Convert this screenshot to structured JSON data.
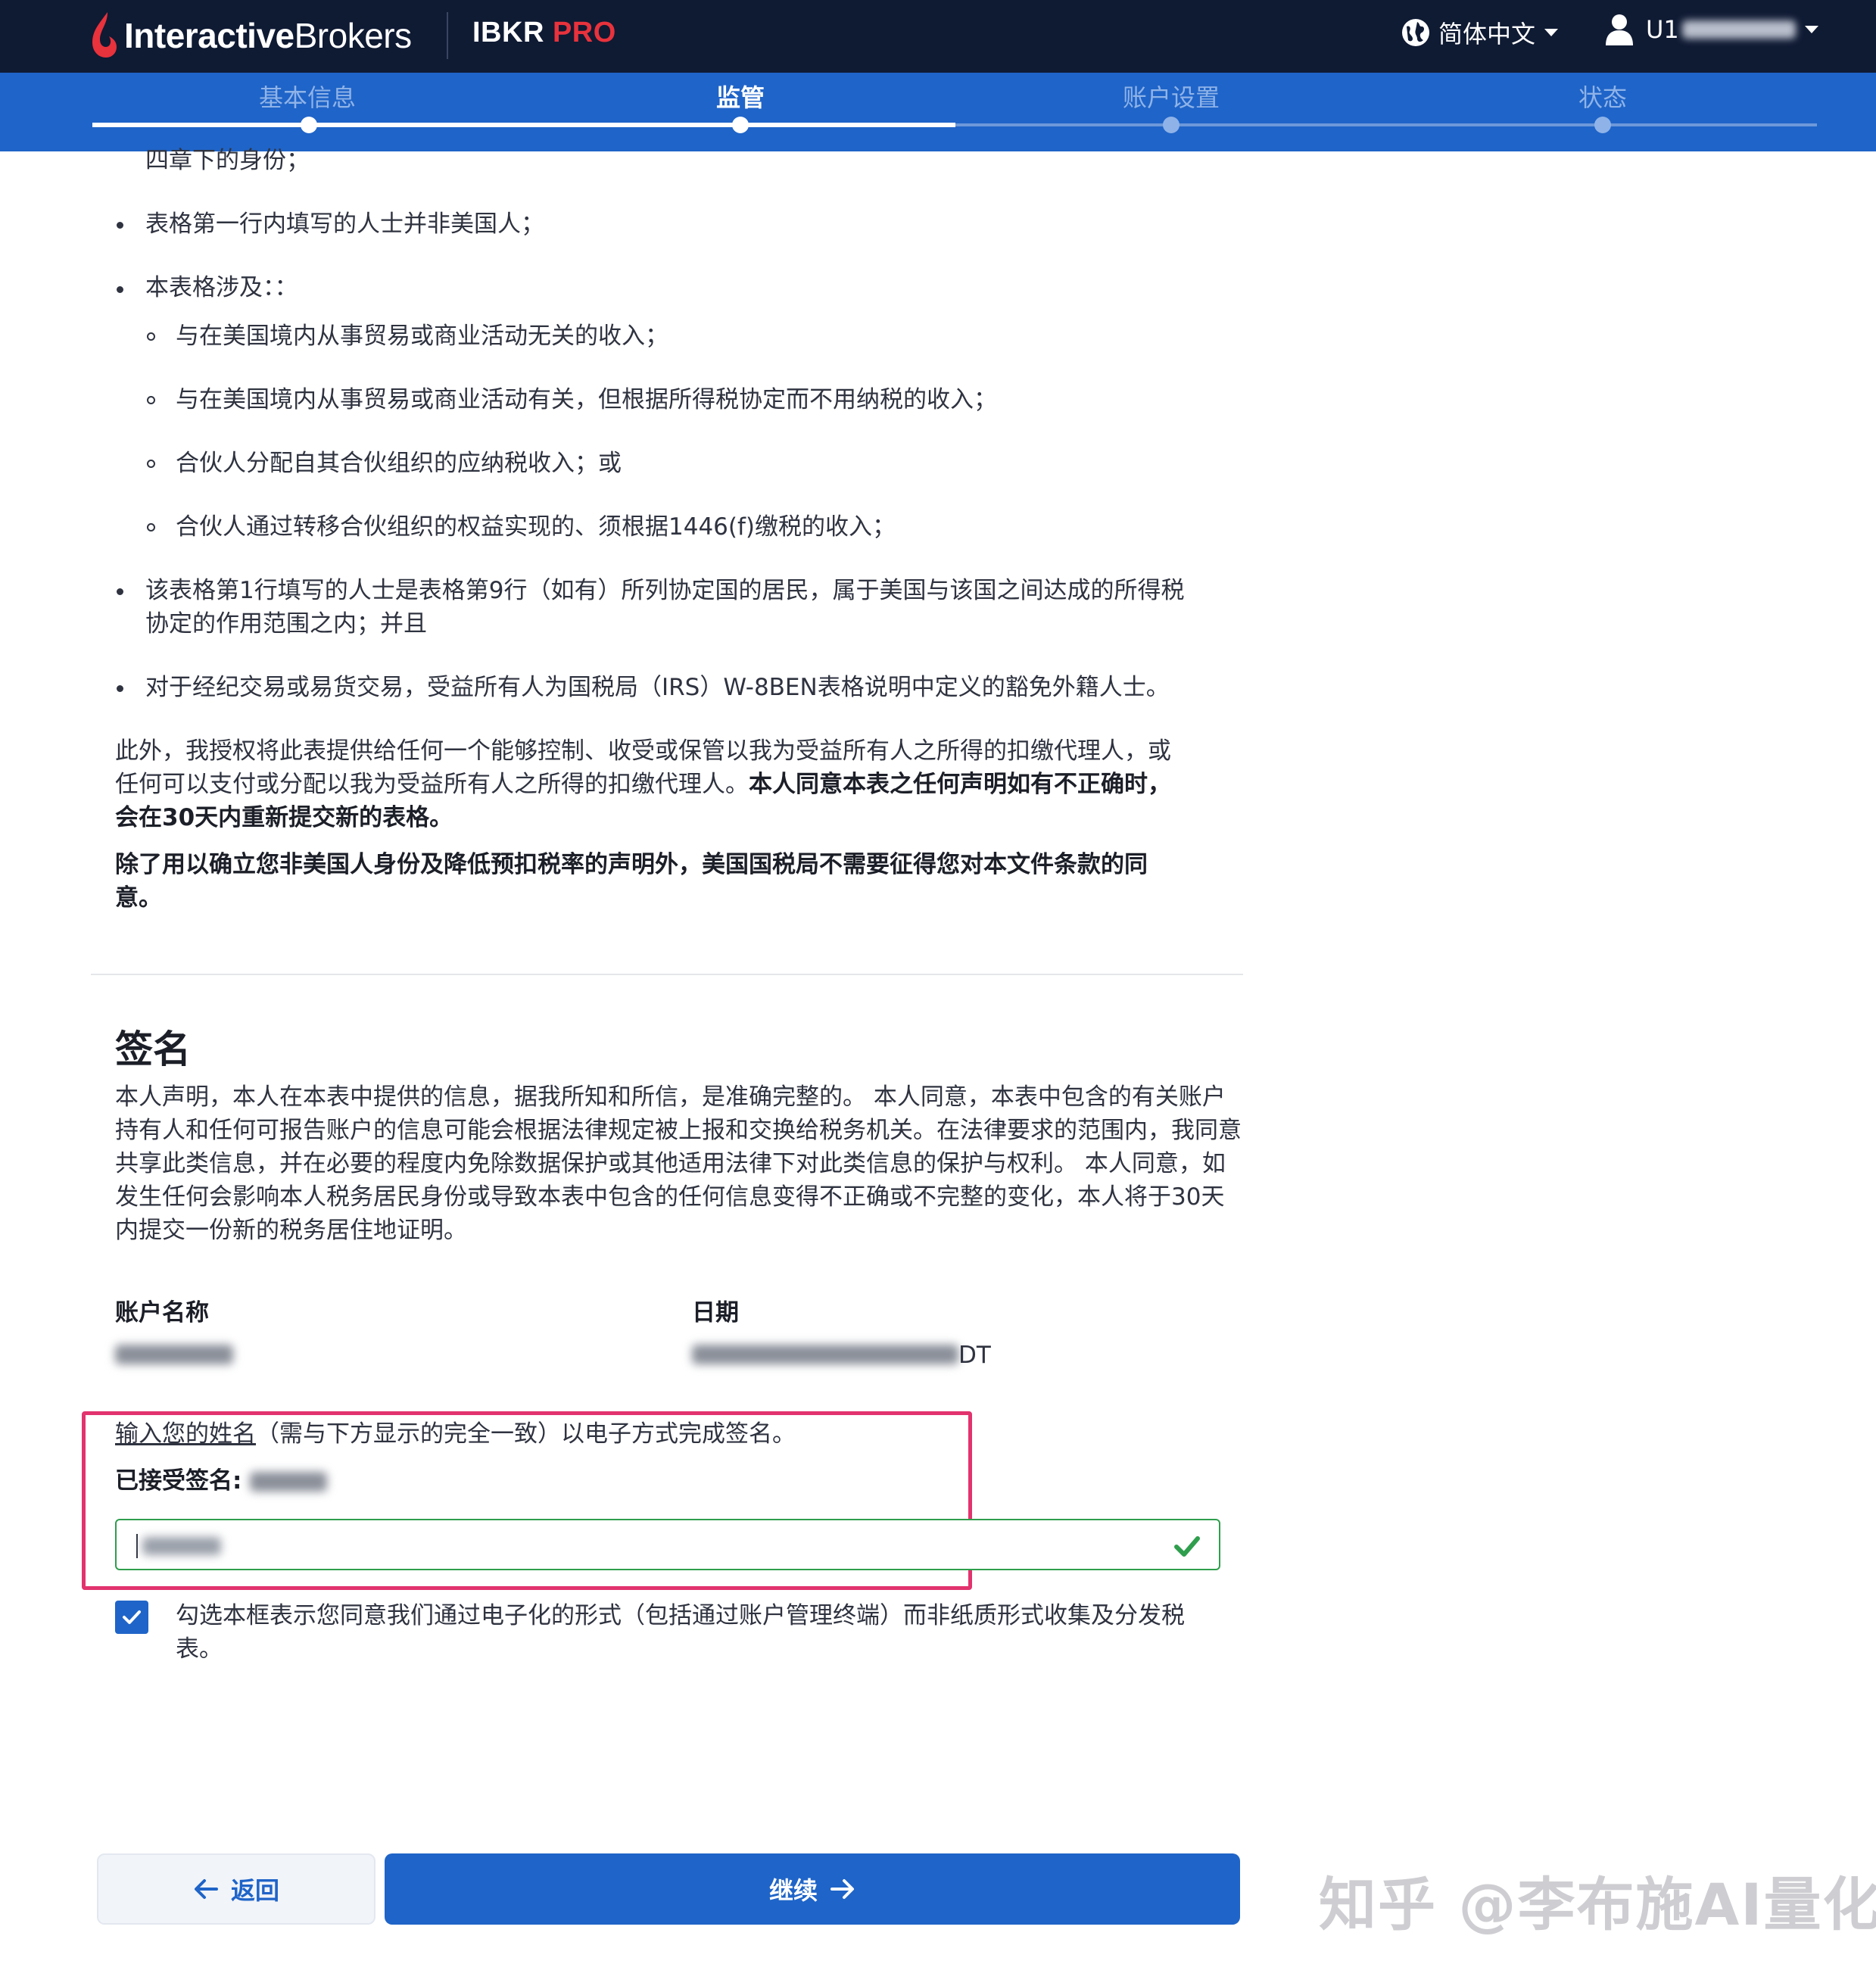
{
  "header": {
    "brand_bold": "Interactive",
    "brand_regular": "Brokers",
    "product": "IBKR",
    "product_accent": "PRO",
    "language": "简体中文",
    "user_prefix": "U1",
    "globe_icon": "globe-icon",
    "user_icon": "user-icon"
  },
  "stepper": {
    "steps": [
      {
        "label": "基本信息",
        "state": "done"
      },
      {
        "label": "监管",
        "state": "active"
      },
      {
        "label": "账户设置",
        "state": "pending"
      },
      {
        "label": "状态",
        "state": "pending"
      }
    ]
  },
  "declarations": {
    "partial_top": "四章下的身份；",
    "bullet_1": "表格第一行内填写的人士并非美国人；",
    "bullet_2": "本表格涉及：：",
    "sub_1": "与在美国境内从事贸易或商业活动无关的收入；",
    "sub_2": "与在美国境内从事贸易或商业活动有关，但根据所得税协定而不用纳税的收入；",
    "sub_3": "合伙人分配自其合伙组织的应纳税收入；或",
    "sub_4": "合伙人通过转移合伙组织的权益实现的、须根据1446(f)缴税的收入；",
    "bullet_3_line1": "该表格第1行填写的人士是表格第9行（如有）所列协定国的居民，属于美国与该国之间达成的所得税",
    "bullet_3_line2": "协定的作用范围之内；并且",
    "bullet_4": "对于经纪交易或易货交易，受益所有人为国税局（IRS）W-8BEN表格说明中定义的豁免外籍人士。",
    "para_1_line1": "此外，我授权将此表提供给任何一个能够控制、收受或保管以我为受益所有人之所得的扣缴代理人，或",
    "para_1_line2": "任何可以支付或分配以我为受益所有人之所得的扣缴代理人。",
    "para_1_bold_a": "本人同意本表之任何声明如有不正确时，",
    "para_1_bold_b": "会在30天内重新提交新的表格。",
    "para_2_line1": "除了用以确立您非美国人身份及降低预扣税率的声明外，美国国税局不需要征得您对本文件条款的同",
    "para_2_line2": "意。"
  },
  "signature": {
    "title": "签名",
    "text_line1": "本人声明，本人在本表中提供的信息，据我所知和所信，是准确完整的。 本人同意，本表中包含的有关账户",
    "text_line2": "持有人和任何可报告账户的信息可能会根据法律规定被上报和交换给税务机关。在法律要求的范围内，我同意",
    "text_line3": "共享此类信息，并在必要的程度内免除数据保护或其他适用法律下对此类信息的保护与权利。 本人同意，如",
    "text_line4": "发生任何会影响本人税务居民身份或导致本表中包含的任何信息变得不正确或不完整的变化，本人将于30天",
    "text_line5": "内提交一份新的税务居住地证明。",
    "account_name_label": "账户名称",
    "date_label": "日期",
    "date_suffix": "DT",
    "instruction_link": "输入您的姓名",
    "instruction_rest": "（需与下方显示的完全一致）以电子方式完成签名。",
    "accepted_label": "已接受签名:",
    "consent_line1": "勾选本框表示您同意我们通过电子化的形式（包括通过账户管理终端）而非纸质形式收集及分发税",
    "consent_line2": "表。",
    "consent_checked": true,
    "input_valid_icon": "check-icon"
  },
  "footer": {
    "back_label": "返回",
    "next_label": "继续"
  },
  "watermark": "知乎 @李布施AI量化",
  "colors": {
    "topbar": "#0f1a33",
    "primary": "#1f64c8",
    "brand_red": "#e8323c",
    "valid_green": "#2f9e4d",
    "highlight_pink": "#e2336f"
  }
}
